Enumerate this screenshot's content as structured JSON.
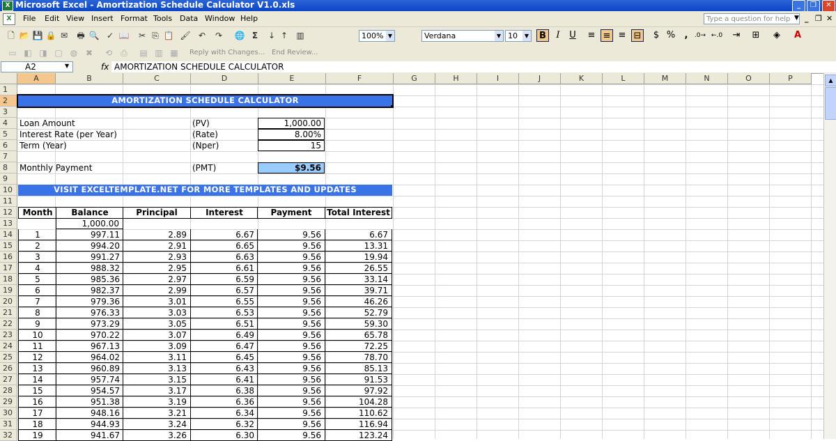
{
  "window": {
    "title": "Microsoft Excel - Amortization Schedule Calculator V1.0.xls"
  },
  "menu": [
    "File",
    "Edit",
    "View",
    "Insert",
    "Format",
    "Tools",
    "Data",
    "Window",
    "Help"
  ],
  "help_placeholder": "Type a question for help",
  "toolbar": {
    "zoom": "100%",
    "font": "Verdana",
    "size": "10",
    "bold": "B",
    "italic": "I",
    "underline": "U",
    "dollar": "$",
    "percent": "%",
    "comma": ",",
    "reply": "Reply with Changes...",
    "end_review": "End Review..."
  },
  "formula_bar": {
    "name_box": "A2",
    "fx": "fx",
    "content": "AMORTIZATION SCHEDULE CALCULATOR"
  },
  "columns": [
    "A",
    "B",
    "C",
    "D",
    "E",
    "F",
    "G",
    "H",
    "I",
    "J",
    "K",
    "L",
    "M",
    "N",
    "O",
    "P"
  ],
  "rows": [
    "1",
    "2",
    "3",
    "4",
    "5",
    "6",
    "7",
    "8",
    "9",
    "10",
    "11",
    "12",
    "13",
    "14",
    "15",
    "16",
    "17",
    "18",
    "19",
    "20",
    "21",
    "22",
    "23",
    "24",
    "25",
    "26",
    "27",
    "28",
    "29",
    "30",
    "31",
    "32"
  ],
  "sheet": {
    "title": "AMORTIZATION SCHEDULE CALCULATOR",
    "loan_label": "Loan Amount",
    "loan_code": "(PV)",
    "loan_value": "1,000.00",
    "rate_label": "Interest Rate (per Year)",
    "rate_code": "(Rate)",
    "rate_value": "8.00%",
    "term_label": "Term (Year)",
    "term_code": "(Nper)",
    "term_value": "15",
    "pmt_label": "Monthly Payment",
    "pmt_code": "(PMT)",
    "pmt_value": "$9.56",
    "banner": "VISIT EXCELTEMPLATE.NET FOR MORE TEMPLATES AND UPDATES",
    "headers": [
      "Month",
      "Balance",
      "Principal",
      "Interest",
      "Payment",
      "Total Interest"
    ],
    "opening_balance": "1,000.00",
    "schedule": [
      [
        "1",
        "997.11",
        "2.89",
        "6.67",
        "9.56",
        "6.67"
      ],
      [
        "2",
        "994.20",
        "2.91",
        "6.65",
        "9.56",
        "13.31"
      ],
      [
        "3",
        "991.27",
        "2.93",
        "6.63",
        "9.56",
        "19.94"
      ],
      [
        "4",
        "988.32",
        "2.95",
        "6.61",
        "9.56",
        "26.55"
      ],
      [
        "5",
        "985.36",
        "2.97",
        "6.59",
        "9.56",
        "33.14"
      ],
      [
        "6",
        "982.37",
        "2.99",
        "6.57",
        "9.56",
        "39.71"
      ],
      [
        "7",
        "979.36",
        "3.01",
        "6.55",
        "9.56",
        "46.26"
      ],
      [
        "8",
        "976.33",
        "3.03",
        "6.53",
        "9.56",
        "52.79"
      ],
      [
        "9",
        "973.29",
        "3.05",
        "6.51",
        "9.56",
        "59.30"
      ],
      [
        "10",
        "970.22",
        "3.07",
        "6.49",
        "9.56",
        "65.78"
      ],
      [
        "11",
        "967.13",
        "3.09",
        "6.47",
        "9.56",
        "72.25"
      ],
      [
        "12",
        "964.02",
        "3.11",
        "6.45",
        "9.56",
        "78.70"
      ],
      [
        "13",
        "960.89",
        "3.13",
        "6.43",
        "9.56",
        "85.13"
      ],
      [
        "14",
        "957.74",
        "3.15",
        "6.41",
        "9.56",
        "91.53"
      ],
      [
        "15",
        "954.57",
        "3.17",
        "6.38",
        "9.56",
        "97.92"
      ],
      [
        "16",
        "951.38",
        "3.19",
        "6.36",
        "9.56",
        "104.28"
      ],
      [
        "17",
        "948.16",
        "3.21",
        "6.34",
        "9.56",
        "110.62"
      ],
      [
        "18",
        "944.93",
        "3.24",
        "6.32",
        "9.56",
        "116.94"
      ],
      [
        "19",
        "941.67",
        "3.26",
        "6.30",
        "9.56",
        "123.24"
      ]
    ]
  },
  "colors": {
    "banner": "#3a73e8",
    "selection": "#f3c78e",
    "pmt_fill": "#99ccff"
  }
}
